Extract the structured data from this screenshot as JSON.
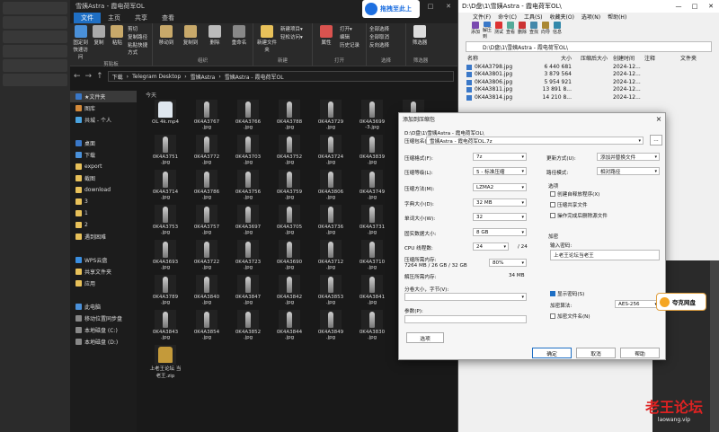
{
  "explorer": {
    "title": "雪姨Astra - 霞电荷军OL",
    "window_controls": [
      "—",
      "□",
      "✕"
    ],
    "tabs": [
      "文件",
      "主页",
      "共享",
      "查看"
    ],
    "ribbon": {
      "groups": [
        {
          "name": "剪贴板",
          "buttons": [
            "固定到快速访问",
            "复制",
            "粘贴"
          ],
          "small": [
            "剪切",
            "复制路径",
            "粘贴快捷方式"
          ]
        },
        {
          "name": "组织",
          "buttons": [
            "移动到",
            "复制到",
            "删除",
            "重命名"
          ]
        },
        {
          "name": "新建",
          "buttons": [
            "新建文件夹"
          ],
          "small": [
            "新建项目▾",
            "轻松访问▾"
          ]
        },
        {
          "name": "打开",
          "buttons": [
            "属性"
          ],
          "small": [
            "打开▾",
            "编辑",
            "历史记录"
          ]
        },
        {
          "name": "选择",
          "small": [
            "全部选择",
            "全部取消",
            "反向选择"
          ]
        },
        {
          "name": "筛选器",
          "buttons": [
            "筛选器"
          ]
        }
      ]
    },
    "address": {
      "nav": [
        "←",
        "→",
        "↑"
      ],
      "crumbs": [
        "下载",
        "Telegram Desktop",
        "雪姨Astra",
        "雪姨Astra - 霞电荷军OL"
      ]
    },
    "sidebar": [
      {
        "label": "★文件夹",
        "sel": true
      },
      {
        "label": "图库"
      },
      {
        "label": "共城 - 个人"
      },
      {
        "label": ""
      },
      {
        "label": "桌面"
      },
      {
        "label": "下载"
      },
      {
        "label": "export"
      },
      {
        "label": "截图"
      },
      {
        "label": "download"
      },
      {
        "label": "3"
      },
      {
        "label": "1"
      },
      {
        "label": "2"
      },
      {
        "label": "遇到困难"
      },
      {
        "label": ""
      },
      {
        "label": "WPS云盘"
      },
      {
        "label": "共享文件夹"
      },
      {
        "label": "应用"
      },
      {
        "label": ""
      },
      {
        "label": "此电脑"
      },
      {
        "label": "移动位置同步盘"
      },
      {
        "label": "本地磁盘 (C:)"
      },
      {
        "label": "本地磁盘 (D:)"
      }
    ],
    "column_header": "今天",
    "files": [
      "OL 4k.mp4",
      "0K4A3767 .jpg",
      "0K4A3766 .jpg",
      "0K4A3788 .jpg",
      "0K4A3729 .jpg",
      "0K4A3699 -3.jpg",
      "0K4A3801 .jpg",
      "0K4A3751 .jpg",
      "0K4A3772 .jpg",
      "0K4A3703 .jpg",
      "0K4A3752 .jpg",
      "0K4A3724 .jpg",
      "0K4A3839 .jpg",
      "0K4A3765 .jpg",
      "0K4A3714 .jpg",
      "0K4A3786 .jpg",
      "0K4A3756 .jpg",
      "0K4A3759 .jpg",
      "0K4A3806 .jpg",
      "0K4A3749 .jpg",
      "0K4A3858 .jpg",
      "0K4A3753 .jpg",
      "0K4A3757 .jpg",
      "0K4A3697 .jpg",
      "0K4A3705 .jpg",
      "0K4A3736 .jpg",
      "0K4A3731 .jpg",
      "0K4A3738 .jpg",
      "0K4A3693 .jpg",
      "0K4A3722 .jpg",
      "0K4A3723 .jpg",
      "0K4A3690 .jpg",
      "0K4A3712 .jpg",
      "0K4A3710 .jpg",
      "0K4A3782 .jpg",
      "0K4A3789 .jpg",
      "0K4A3840 .jpg",
      "0K4A3847 .jpg",
      "0K4A3842 .jpg",
      "0K4A3853 .jpg",
      "0K4A3841 .jpg",
      "0K4A3834 .jpg",
      "0K4A3843 .jpg",
      "0K4A3854 .jpg",
      "0K4A3852 .jpg",
      "0K4A3844 .jpg",
      "0K4A3849 .jpg",
      "0K4A3830 .jpg",
      "0K4A3850 .jpg",
      "上老王论坛 当老王.zip"
    ]
  },
  "badge": {
    "label": "拖拽至此上"
  },
  "winrar": {
    "title": "D:\\D盘\\1\\雪姨Astra - 霞电荷军OL\\",
    "window_controls": [
      "—",
      "□",
      "✕"
    ],
    "menu": [
      "文件(F)",
      "命令(C)",
      "工具(S)",
      "收藏夹(O)",
      "选项(N)",
      "帮助(H)"
    ],
    "tools": [
      "添加",
      "解压到",
      "测试",
      "查看",
      "删除",
      "查找",
      "向导",
      "信息"
    ],
    "path": "D:\\D盘\\1\\雪姨Astra - 霞电荷军OL\\",
    "headers": [
      "名称",
      "大小",
      "压缩后大小",
      "创建时间",
      "注释",
      "文件夹"
    ],
    "rows": [
      {
        "name": "0K4A3798.jpg",
        "size": "6 440 681",
        "date": "2024-12..."
      },
      {
        "name": "0K4A3801.jpg",
        "size": "3 879 564",
        "date": "2024-12..."
      },
      {
        "name": "0K4A3806.jpg",
        "size": "5 954 921",
        "date": "2024-12..."
      },
      {
        "name": "0K4A3811.jpg",
        "size": "13 891 8...",
        "date": "2024-12..."
      },
      {
        "name": "0K4A3814.jpg",
        "size": "14 210 8...",
        "date": "2024-12..."
      }
    ]
  },
  "dialog": {
    "title": "添加到压缩包",
    "archive_path": "D:\\D盘\\1\\雪姨Astra - 霞电荷军OL\\",
    "archive_name": "雪姨Astra - 霞电荷军OL.7z",
    "browse": "...",
    "labels": {
      "format": "压缩格式(F):",
      "level": "压缩等级(L):",
      "method": "压缩方法(M):",
      "dict": "字典大小(D):",
      "word": "单词大小(W):",
      "solid": "固实数据大小:",
      "threads": "CPU 线程数:",
      "mem": "压缩所需内存:",
      "mem_detail": "7264 MB / 26 GB / 32 GB",
      "dmem": "解压所需内存:",
      "split": "分卷大小，字节(V):",
      "params": "参数(P):",
      "update": "更新方式(U):",
      "pathmode": "路径模式:",
      "options": "选项",
      "encrypt": "加密",
      "pwd": "输入密码:",
      "enc_method": "加密算法:"
    },
    "values": {
      "format": "7z",
      "level": "5 - 标准压缩",
      "method": "LZMA2",
      "dict": "32 MB",
      "word": "32",
      "solid": "8 GB",
      "threads": "24",
      "threads_max": "/ 24",
      "mem_pct": "80%",
      "dmem": "34 MB",
      "update": "添加并替换文件",
      "pathmode": "相对路径",
      "password": "上老王论坛当老王",
      "enc_method": "AES-256"
    },
    "checkboxes": [
      "创建自释放程序(X)",
      "压缩共享文件",
      "操作完成后删除源文件"
    ],
    "show_pwd": "显示密码(S)",
    "encrypt_names": "加密文件名(N)",
    "buttons": {
      "options": "选项",
      "ok": "确定",
      "cancel": "取消",
      "help": "帮助"
    }
  },
  "cloud": {
    "label": "夸克网盘"
  },
  "watermark": {
    "title": "老王论坛",
    "url": "laowang.vip"
  }
}
